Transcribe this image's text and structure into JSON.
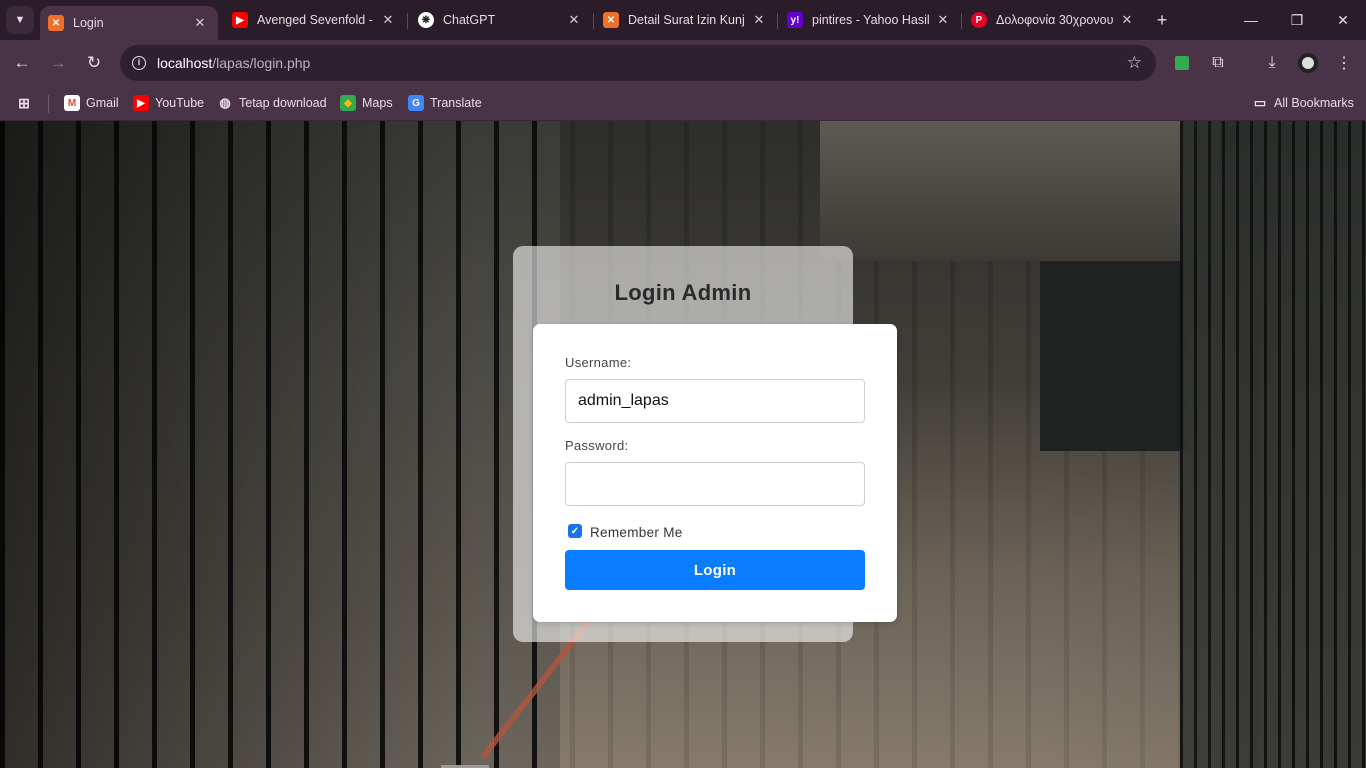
{
  "browser": {
    "tabs": [
      {
        "title": "Login",
        "icon": "xampp-icon",
        "active": true
      },
      {
        "title": "Avenged Sevenfold -",
        "icon": "youtube-icon"
      },
      {
        "title": "ChatGPT",
        "icon": "chatgpt-icon"
      },
      {
        "title": "Detail Surat Izin Kunju",
        "icon": "xampp-icon"
      },
      {
        "title": "pintires - Yahoo Hasil",
        "icon": "yahoo-icon"
      },
      {
        "title": "Δολοφονία 30χρονου",
        "icon": "pinterest-icon"
      }
    ],
    "address": {
      "host": "localhost",
      "path": "/lapas/login.php"
    },
    "bookmarks": [
      "Gmail",
      "YouTube",
      "Tetap download",
      "Maps",
      "Translate"
    ],
    "all_bookmarks_label": "All Bookmarks",
    "colors": {
      "frame": "#2a1c29",
      "toolbar": "#4a3346"
    }
  },
  "login": {
    "title": "Login Admin",
    "username_label": "Username:",
    "username_value": "admin_lapas",
    "password_label": "Password:",
    "password_value": "",
    "remember_label": "Remember Me",
    "remember_checked": true,
    "button_label": "Login",
    "colors": {
      "button": "#0a7cff"
    }
  }
}
